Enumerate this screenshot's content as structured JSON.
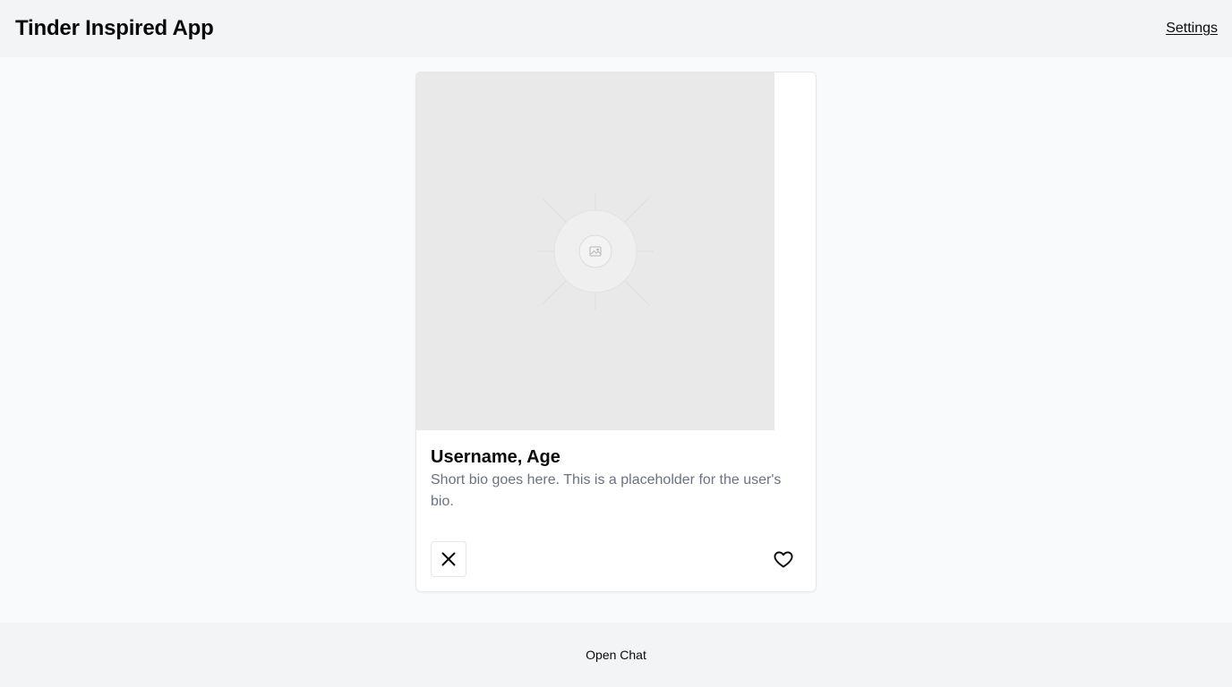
{
  "header": {
    "title": "Tinder Inspired App",
    "settings_label": "Settings"
  },
  "profile_card": {
    "photo_icon": "image-placeholder-icon",
    "username_age": "Username, Age",
    "bio": "Short bio goes here. This is a placeholder for the user's bio.",
    "pass_icon": "close-icon",
    "like_icon": "heart-icon"
  },
  "footer": {
    "open_chat_label": "Open Chat"
  }
}
